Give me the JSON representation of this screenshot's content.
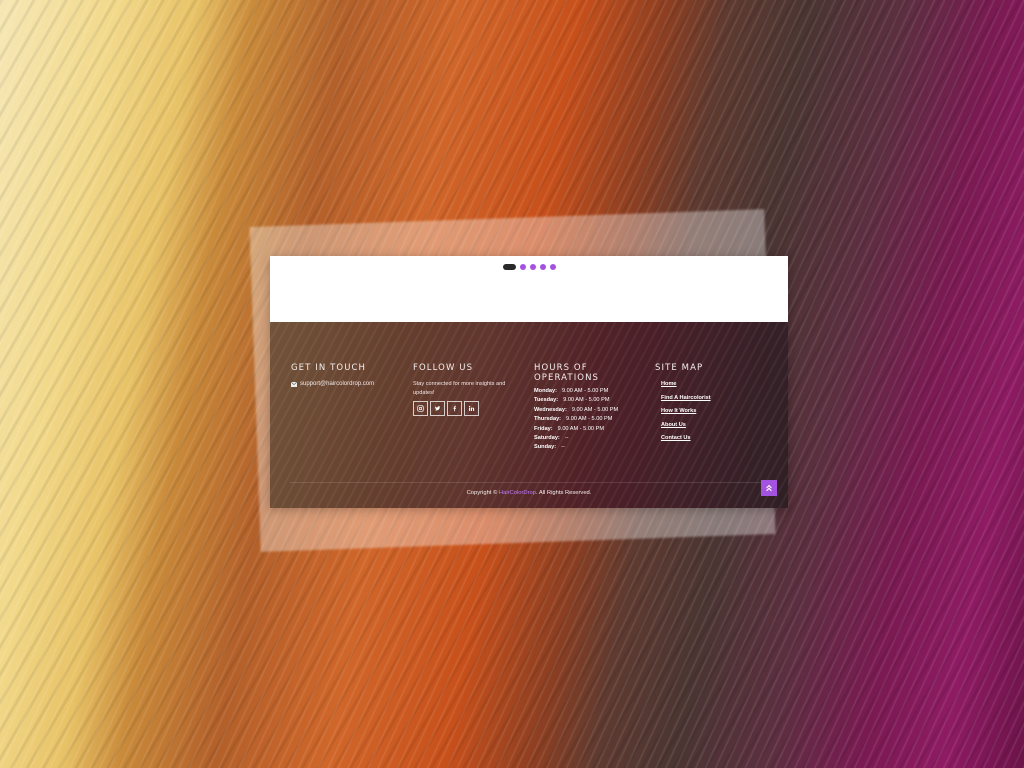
{
  "carousel": {
    "slide_count": 5,
    "active_index": 0
  },
  "footer": {
    "contact": {
      "heading": "GET IN TOUCH",
      "email": "support@haircolordrop.com",
      "icon": "mail-icon"
    },
    "follow": {
      "heading": "FOLLOW US",
      "text": "Stay connected for more insights and updates!",
      "social": [
        {
          "name": "instagram",
          "icon": "instagram-icon"
        },
        {
          "name": "twitter",
          "icon": "twitter-icon"
        },
        {
          "name": "facebook",
          "icon": "facebook-icon"
        },
        {
          "name": "linkedin",
          "icon": "linkedin-icon"
        }
      ]
    },
    "hours": {
      "heading": "HOURS OF OPERATIONS",
      "rows": [
        {
          "day": "Monday:",
          "time": "9.00 AM - 5.00 PM"
        },
        {
          "day": "Tuesday:",
          "time": "9.00 AM - 5.00 PM"
        },
        {
          "day": "Wednesday:",
          "time": "9.00 AM - 5.00 PM"
        },
        {
          "day": "Thursday:",
          "time": "9.00 AM - 5.00 PM"
        },
        {
          "day": "Friday:",
          "time": "9.00 AM - 5.00 PM"
        },
        {
          "day": "Saturday:",
          "time": "--"
        },
        {
          "day": "Sunday:",
          "time": "--"
        }
      ]
    },
    "sitemap": {
      "heading": "SITE MAP",
      "links": [
        "Home",
        "Find A Haircolorist",
        "How It Works",
        "About Us",
        "Contact Us"
      ]
    },
    "copyright": {
      "prefix": "Copyright ©",
      "brand": "HairColorDrop",
      "suffix": ". All Rights Reserved."
    }
  },
  "colors": {
    "accent": "#a453e0",
    "active_dot": "#2a2a2a",
    "brand_link": "#c07bff"
  }
}
